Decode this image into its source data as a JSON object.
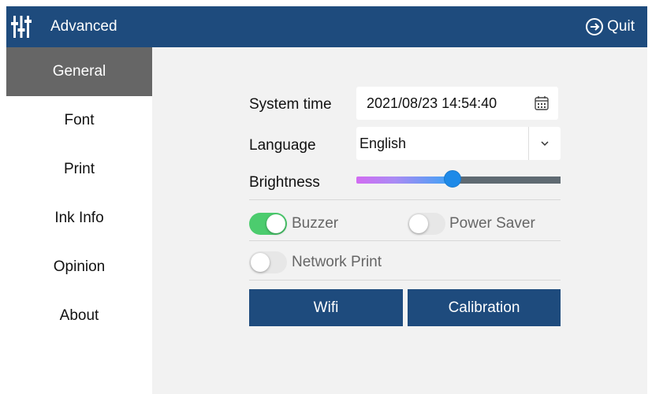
{
  "header": {
    "title": "Advanced",
    "quit_label": "Quit",
    "icons": {
      "app": "sliders-icon",
      "quit": "logout-arrow-icon"
    },
    "colors": {
      "brand": "#1e4b7d"
    }
  },
  "sidebar": {
    "items": [
      {
        "label": "General",
        "active": true
      },
      {
        "label": "Font",
        "active": false
      },
      {
        "label": "Print",
        "active": false
      },
      {
        "label": "Ink Info",
        "active": false
      },
      {
        "label": "Opinion",
        "active": false
      },
      {
        "label": "About",
        "active": false
      }
    ]
  },
  "settings": {
    "system_time": {
      "label": "System time",
      "value": "2021/08/23 14:54:40",
      "icon": "calendar-icon"
    },
    "language": {
      "label": "Language",
      "value": "English",
      "icon": "chevron-down-icon"
    },
    "brightness": {
      "label": "Brightness",
      "level": 0.48
    },
    "buzzer": {
      "label": "Buzzer",
      "on": true
    },
    "power_saver": {
      "label": "Power Saver",
      "on": false
    },
    "network_print": {
      "label": "Network Print",
      "on": false
    },
    "toggle_on_color": "#4ccc6e"
  },
  "actions": {
    "wifi_label": "Wifi",
    "calibration_label": "Calibration"
  }
}
